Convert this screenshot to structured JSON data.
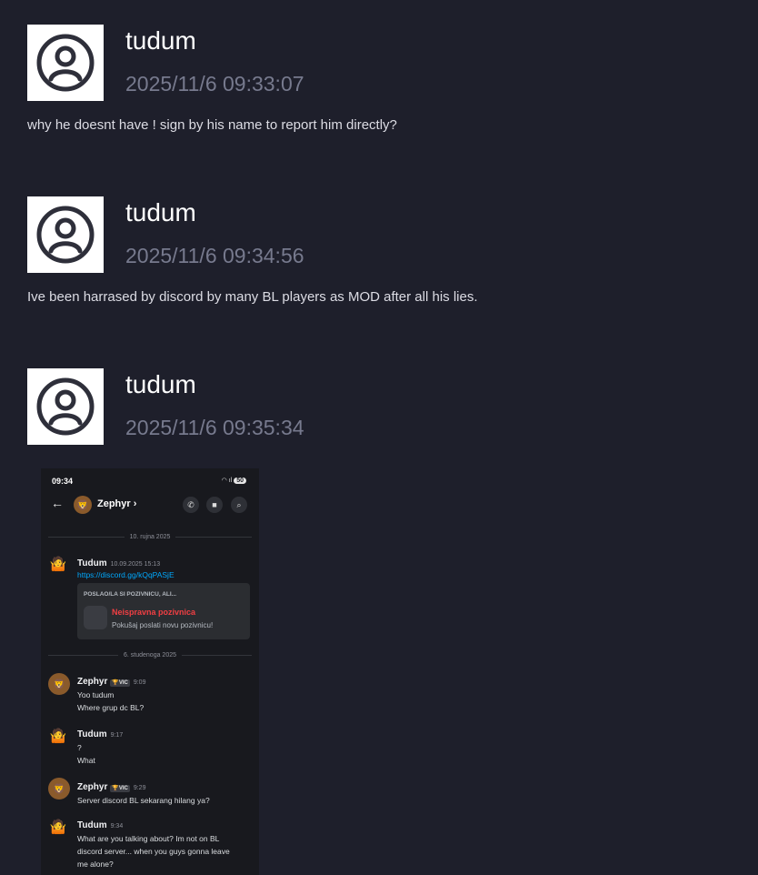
{
  "messages": [
    {
      "username": "tudum",
      "timestamp": "2025/11/6 09:33:07",
      "text": "why he doesnt have ! sign by his name to report him directly?"
    },
    {
      "username": "tudum",
      "timestamp": "2025/11/6 09:34:56",
      "text": "Ive been harrased by discord by many BL players as MOD after all his lies."
    },
    {
      "username": "tudum",
      "timestamp": "2025/11/6 09:35:34",
      "text": ""
    }
  ],
  "screenshot": {
    "status_time": "09:34",
    "battery": "50",
    "contact_name": "Zephyr",
    "date_divider_1": "10. rujna 2025",
    "date_divider_2": "6. studenoga 2025",
    "vic_badge": "VIC",
    "chat": [
      {
        "name": "Tudum",
        "time": "10.09.2025 15:13",
        "lines": [
          "https://discord.gg/kQqPASjE"
        ]
      },
      {
        "name": "Zephyr",
        "time": "9:09",
        "lines": [
          "Yoo tudum",
          "Where grup dc BL?"
        ]
      },
      {
        "name": "Tudum",
        "time": "9:17",
        "lines": [
          "?",
          "What"
        ]
      },
      {
        "name": "Zephyr",
        "time": "9:29",
        "lines": [
          "Server discord BL sekarang hilang ya?"
        ]
      },
      {
        "name": "Tudum",
        "time": "9:34",
        "lines": [
          "What are you talking about? Im not on BL",
          "discord server... when you guys gonna leave",
          "me alone?"
        ]
      }
    ],
    "embed": {
      "header": "POSLAO/LA SI POZIVNICU, ALI...",
      "title": "Neispravna pozivnica",
      "subtitle": "Pokušaj poslati novu pozivnicu!"
    }
  },
  "colors": {
    "background": "#1e1f2b",
    "timestamp": "#777a8e",
    "link": "#00a8fc",
    "invalid": "#f23f43"
  }
}
